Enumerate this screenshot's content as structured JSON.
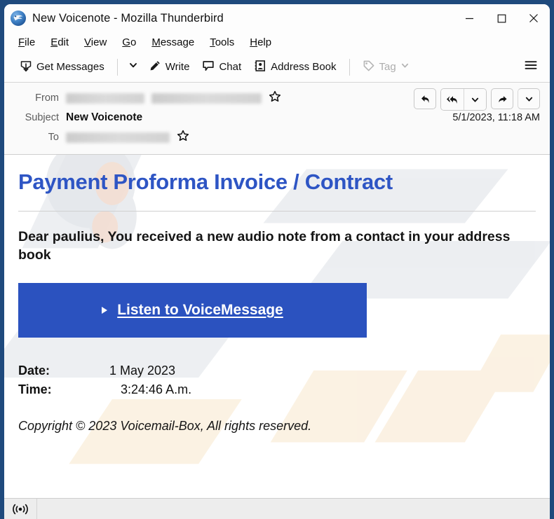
{
  "window": {
    "title": "New Voicenote - Mozilla Thunderbird",
    "app_icon": "thunderbird-logo-icon",
    "controls": {
      "minimize": "minimize-icon",
      "maximize": "maximize-icon",
      "close": "close-icon"
    }
  },
  "menubar": {
    "items": [
      {
        "label": "File",
        "accel": "F"
      },
      {
        "label": "Edit",
        "accel": "E"
      },
      {
        "label": "View",
        "accel": "V"
      },
      {
        "label": "Go",
        "accel": "G"
      },
      {
        "label": "Message",
        "accel": "M"
      },
      {
        "label": "Tools",
        "accel": "T"
      },
      {
        "label": "Help",
        "accel": "H"
      }
    ]
  },
  "toolbar": {
    "get_messages_label": "Get Messages",
    "get_messages_icon": "download-inbox-icon",
    "get_messages_chevron": "chevron-down-icon",
    "write_label": "Write",
    "write_icon": "pencil-icon",
    "chat_label": "Chat",
    "chat_icon": "speech-bubble-icon",
    "address_book_label": "Address Book",
    "address_book_icon": "contact-card-icon",
    "tag_label": "Tag",
    "tag_icon": "tag-icon",
    "tag_chevron": "chevron-down-icon",
    "tag_disabled": true,
    "app_menu_icon": "hamburger-menu-icon"
  },
  "message_header": {
    "from_label": "From",
    "from_value_redacted": true,
    "subject_label": "Subject",
    "subject_value": "New Voicenote",
    "to_label": "To",
    "to_value_redacted": true,
    "date": "5/1/2023, 11:18 AM",
    "star_icon": "star-outline-icon",
    "actions": {
      "reply": "reply-icon",
      "reply_all": "reply-all-icon",
      "reply_menu": "chevron-down-icon",
      "forward": "forward-arrow-icon",
      "more_menu": "chevron-down-icon"
    }
  },
  "mail_body": {
    "heading": "Payment Proforma Invoice / Contract",
    "greeting": "Dear paulius, You received a new audio note from a contact in your address book",
    "button_label": "Listen to VoiceMessage",
    "button_icon": "play-triangle-icon",
    "date_label": "Date:",
    "date_value": "1 May  2023",
    "time_label": "Time:",
    "time_value": "3:24:46 A.m.",
    "copyright": "Copyright © 2023 Voicemail-Box, All rights reserved."
  },
  "statusbar": {
    "connection_icon": "broadcast-online-icon",
    "text": ""
  },
  "colors": {
    "window_border": "#1f4a7d",
    "heading_blue": "#2e55c4",
    "button_blue": "#2b52bf",
    "toolbar_bg": "#fdfdfd",
    "header_bg": "#fafafa",
    "statusbar_bg": "#ededed"
  }
}
